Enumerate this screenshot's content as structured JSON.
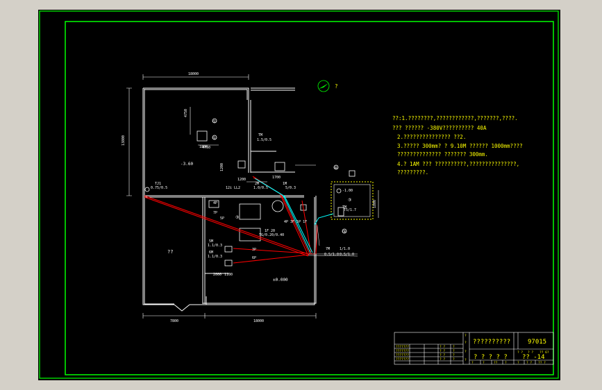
{
  "colors": {
    "window_bg": "#d4d0c8",
    "canvas_bg": "#000000",
    "frame": "#00ff00",
    "walls": "#ffffff",
    "cable_red": "#ff0000",
    "cable_cyan": "#00ffff",
    "text_yellow": "#ffff00",
    "text_white": "#ffffff"
  },
  "north_arrow": {
    "label": "?"
  },
  "dimensions": {
    "top_width": "18000",
    "left_height": "13800",
    "inner_h1": "4750",
    "inner_w1": "4750",
    "bottom_left": "7800",
    "bottom_right": "18000",
    "aux_a": "1800",
    "aux_b": "1200",
    "aux_c": "1700",
    "aux_d": "1200",
    "aux_e": "1800",
    "aux_f": "2000",
    "aux_g": "1100"
  },
  "labels": {
    "level_upper": "-3.60",
    "level_lower": "±0.000",
    "level_pit": "-1.00",
    "room_unknown": "??",
    "circle_1": "①",
    "circle_3": "③",
    "circle_4": "④",
    "tag_tj1_a": "TJ1",
    "tag_tj1_b": "0.75/0.5",
    "tag_tm": "TM",
    "tag_tm_val": "1.5/0.5",
    "tag_12i": "12i LL2",
    "tag_2m": "2M",
    "tag_2m_val": "1.0/0.5",
    "tag_1m": "1M",
    "tag_1m_val": "5/0.3",
    "tag_5p": "5P",
    "tag_7p": "7P",
    "tag_4p": "4P",
    "tag_5m": "5M",
    "tag_5m_val": "1.1/0.3",
    "tag_6m": "6M",
    "tag_6m_val": "1.1/0.3",
    "tag_3p": "3P",
    "tag_6p": "6P",
    "tag_4p3f": "4P 3F 5P 1F",
    "tag_1f": "1F 20",
    "tag_tg": "TG/0.20/0.40",
    "tag_side_a": "7M",
    "tag_side_b": "1/1.0",
    "tag_side_c": "0.5/1.0",
    "tag_side_d": "0.5/1.0",
    "tag_pit_a": "TM",
    "tag_pit_b": "T5/1.7"
  },
  "notes": [
    "??:1.????????,????????????,???????,????.",
    "    ??? ??????  -380V??????????    40A",
    "2.???????????????    ??2.",
    "3.????? 300mm?   ? 9.10M ??????   1000mm????",
    "    ??????????????    ???????    300mm.",
    "4.? 1AM ??? ??????????,???????????????,",
    "    ?????????."
  ],
  "title_block": {
    "title": "??????????",
    "drawing_no": "97015",
    "subtitle": "? ? ? ? ?",
    "sheet": "?? -14",
    "left_col": [
      "?",
      "?",
      "?",
      "?"
    ],
    "grid_rows": [
      [
        "???????",
        "",
        "? ?",
        "?"
      ],
      [
        "???????",
        "",
        "? ?",
        "?"
      ],
      [
        "???????",
        "",
        "? ?",
        "?"
      ],
      [
        "???????",
        "",
        "? ?",
        "?"
      ]
    ],
    "bottom_row": [
      "?",
      "?",
      "??",
      "?",
      "?",
      "? ?",
      "?? ?"
    ],
    "footer": [
      "? ?",
      "? ?",
      "?? 6?"
    ]
  }
}
